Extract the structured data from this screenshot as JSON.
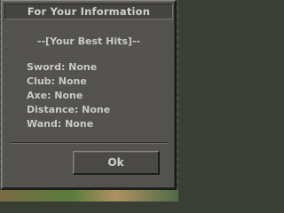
{
  "window": {
    "title": "For Your Information"
  },
  "content": {
    "header": "--[Your Best Hits]--",
    "hits": [
      {
        "label": "Sword: None"
      },
      {
        "label": "Club: None"
      },
      {
        "label": "Axe: None"
      },
      {
        "label": "Distance: None"
      },
      {
        "label": "Wand: None"
      }
    ]
  },
  "buttons": {
    "ok_label": "Ok"
  }
}
